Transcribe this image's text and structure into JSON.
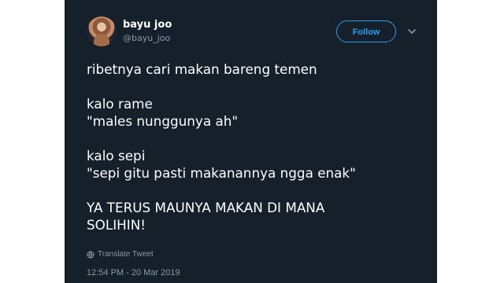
{
  "user": {
    "display_name": "bayu joo",
    "username": "@bayu_joo"
  },
  "actions": {
    "follow_label": "Follow"
  },
  "tweet": {
    "lines": [
      "ribetnya cari makan bareng temen",
      "",
      "kalo rame",
      "\"males nunggunya ah\"",
      "",
      "kalo sepi",
      "\"sepi gitu pasti makanannya ngga enak\"",
      "",
      "YA TERUS MAUNYA MAKAN DI MANA",
      "SOLIHIN!"
    ],
    "translate_label": "Translate Tweet",
    "timestamp": "12:54 PM - 20 Mar 2019"
  },
  "icons": {
    "avatar": "user-avatar",
    "more": "chevron-down-icon",
    "translate": "globe-icon"
  },
  "colors": {
    "background": "#15202b",
    "text": "#ffffff",
    "muted": "#8899a6",
    "accent": "#1da1f2",
    "page": "#ffffff"
  }
}
